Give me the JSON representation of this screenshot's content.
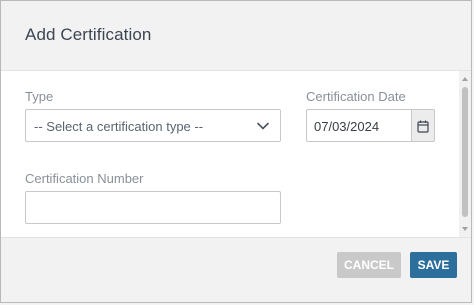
{
  "dialog": {
    "title": "Add Certification"
  },
  "form": {
    "type": {
      "label": "Type",
      "selected": "-- Select a certification type --"
    },
    "certification_date": {
      "label": "Certification Date",
      "value": "07/03/2024"
    },
    "certification_number": {
      "label": "Certification Number",
      "value": ""
    }
  },
  "footer": {
    "cancel_label": "CANCEL",
    "save_label": "SAVE"
  },
  "icons": {
    "type_dropdown": "chevron-down-icon",
    "date_picker": "calendar-icon"
  },
  "colors": {
    "save_button": "#2c6f9d",
    "cancel_button": "#c9c9c9",
    "header_background": "#f2f2f2"
  }
}
